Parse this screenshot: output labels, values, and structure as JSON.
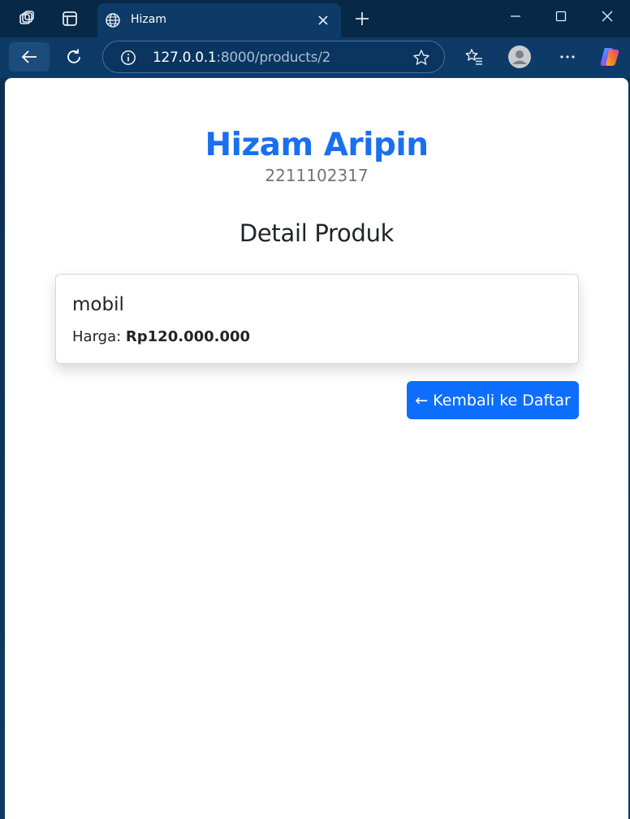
{
  "browser": {
    "tab": {
      "title": "Hizam"
    },
    "address": {
      "host": "127.0.0.1",
      "rest": ":8000/products/2"
    },
    "colors": {
      "chrome": "#0d3a66",
      "titlebar": "#072846"
    }
  },
  "page": {
    "name": "Hizam Aripin",
    "student_id": "2211102317",
    "section_title": "Detail Produk",
    "product": {
      "name": "mobil",
      "price_label": "Harga:",
      "price_value": "Rp120.000.000"
    },
    "back_button_label": "← Kembali ke Daftar",
    "colors": {
      "accent": "#0d6efd",
      "title": "#1a6ff0",
      "muted": "#6c757d"
    }
  },
  "icons": [
    "workspaces-icon",
    "tab-actions-icon",
    "globe-icon",
    "close-tab-icon",
    "new-tab-icon",
    "minimize-icon",
    "maximize-icon",
    "close-window-icon",
    "back-icon",
    "reload-icon",
    "info-icon",
    "favorite-star-icon",
    "favorites-icon",
    "profile-avatar-icon",
    "more-icon",
    "copilot-icon"
  ]
}
